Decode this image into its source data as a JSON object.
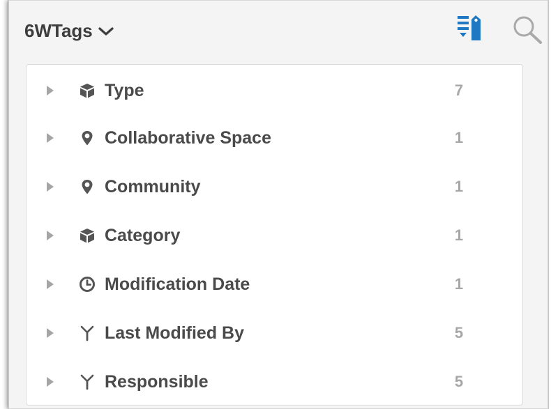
{
  "header": {
    "title": "6WTags",
    "tag_icon": "tag-list-icon",
    "search_icon": "search-icon",
    "accent_color": "#1f78c1"
  },
  "tags": [
    {
      "label": "Type",
      "icon": "cube-icon",
      "count": "7"
    },
    {
      "label": "Collaborative Space",
      "icon": "location-pin-icon",
      "count": "1"
    },
    {
      "label": "Community",
      "icon": "location-pin-icon",
      "count": "1"
    },
    {
      "label": "Category",
      "icon": "cube-icon",
      "count": "1"
    },
    {
      "label": "Modification Date",
      "icon": "clock-icon",
      "count": "1"
    },
    {
      "label": "Last Modified By",
      "icon": "person-icon",
      "count": "5"
    },
    {
      "label": "Responsible",
      "icon": "person-icon",
      "count": "5"
    }
  ]
}
